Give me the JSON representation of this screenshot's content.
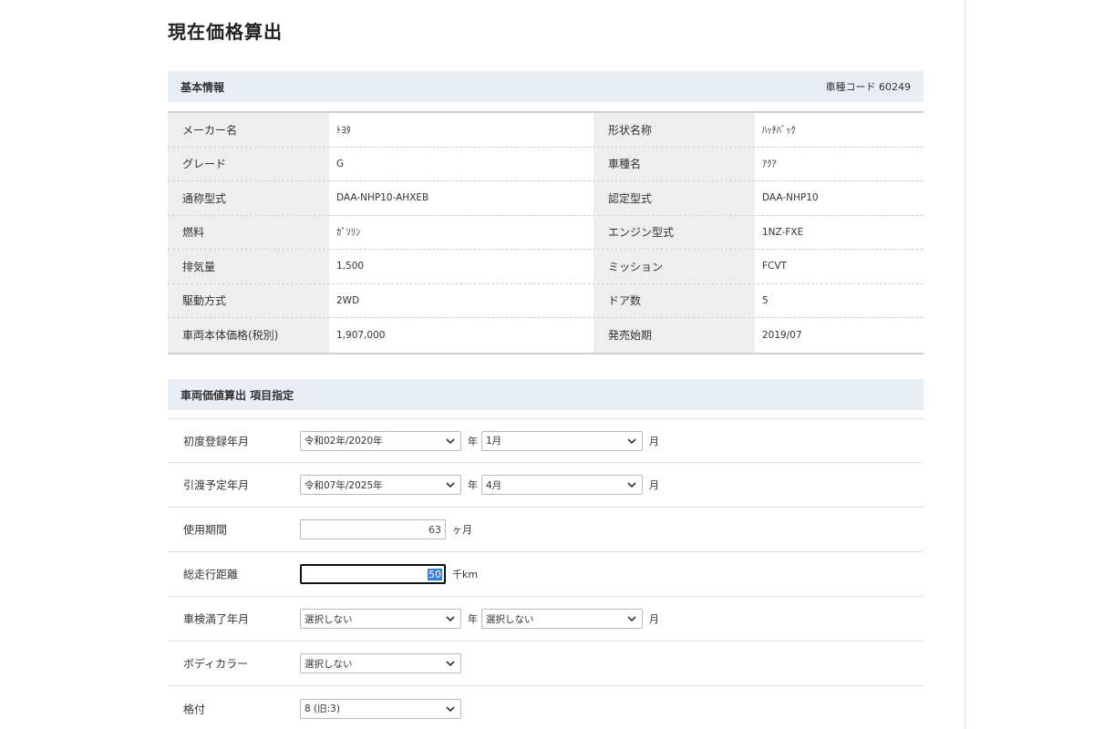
{
  "page_title": "現在価格算出",
  "basic_info": {
    "header": "基本情報",
    "model_code": "車種コード 60249",
    "rows": [
      {
        "l_label": "メーカー名",
        "l_value": "ﾄﾖﾀ",
        "r_label": "形状名称",
        "r_value": "ﾊｯﾁﾊﾞｯｸ"
      },
      {
        "l_label": "グレード",
        "l_value": "G",
        "r_label": "車種名",
        "r_value": "ｱｸｱ"
      },
      {
        "l_label": "通称型式",
        "l_value": "DAA-NHP10-AHXEB",
        "r_label": "認定型式",
        "r_value": "DAA-NHP10"
      },
      {
        "l_label": "燃料",
        "l_value": "ｶﾞｿﾘﾝ",
        "r_label": "エンジン型式",
        "r_value": "1NZ-FXE"
      },
      {
        "l_label": "排気量",
        "l_value": "1,500",
        "r_label": "ミッション",
        "r_value": "FCVT"
      },
      {
        "l_label": "駆動方式",
        "l_value": "2WD",
        "r_label": "ドア数",
        "r_value": "5"
      },
      {
        "l_label": "車両本体価格(税別)",
        "l_value": "1,907,000",
        "r_label": "発売始期",
        "r_value": "2019/07"
      }
    ]
  },
  "valuation": {
    "header": "車両価値算出 項目指定",
    "first_registration": {
      "label": "初度登録年月",
      "year": "令和02年/2020年",
      "year_unit": "年",
      "month": "1月",
      "month_unit": "月"
    },
    "transfer_planned": {
      "label": "引渡予定年月",
      "year": "令和07年/2025年",
      "year_unit": "年",
      "month": "4月",
      "month_unit": "月"
    },
    "usage_period": {
      "label": "使用期間",
      "value": "63",
      "unit": "ヶ月"
    },
    "total_mileage": {
      "label": "総走行距離",
      "value": "50",
      "unit": "千km"
    },
    "inspection_expiry": {
      "label": "車検満了年月",
      "year": "選択しない",
      "year_unit": "年",
      "month": "選択しない",
      "month_unit": "月"
    },
    "body_color": {
      "label": "ボディカラー",
      "value": "選択しない"
    },
    "grade_rank": {
      "label": "格付",
      "value": "8 (旧:3)"
    }
  }
}
